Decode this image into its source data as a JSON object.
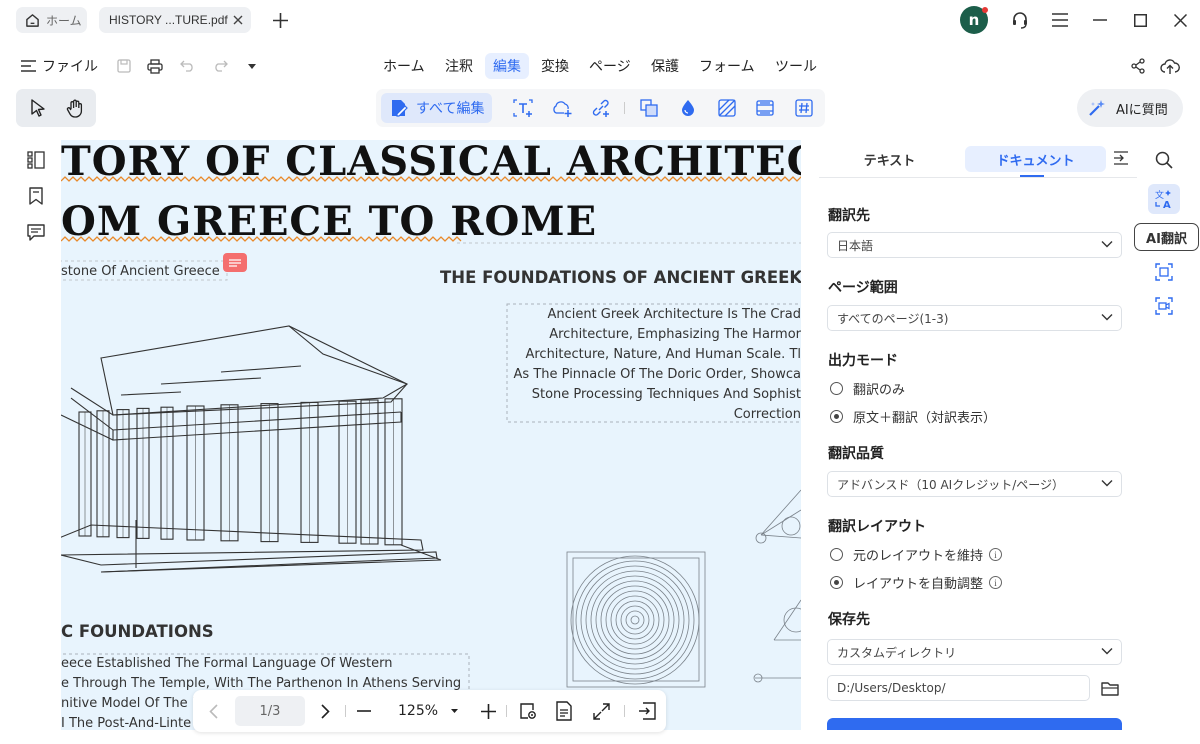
{
  "titlebar": {
    "home_tab": "ホーム",
    "doc_tab": "HISTORY ...TURE.pdf",
    "avatar_letter": "n"
  },
  "menubar": {
    "file_label": "ファイル",
    "tabs": [
      "ホーム",
      "注釈",
      "編集",
      "変換",
      "ページ",
      "保護",
      "フォーム",
      "ツール"
    ],
    "active_tab": "編集"
  },
  "toolbar": {
    "edit_all_label": "すべて編集",
    "ai_ask_label": "AIに質問"
  },
  "document": {
    "title_line1": "TORY OF CLASSICAL  ARCHITECTUR",
    "title_line2": "OM GREECE TO ROME",
    "caption": "stone Of Ancient Greece",
    "heading_right": "THE FOUNDATIONS OF ANCIENT GREEK AR",
    "para_right": [
      "Ancient Greek Architecture Is The Crad",
      "Architecture, Emphasizing The Harmor",
      "Architecture, Nature, And Human Scale. Tl",
      "As The Pinnacle Of The Doric Order, Showca",
      "Stone Processing Techniques And Sophist",
      "Correction"
    ],
    "heading_left": "C FOUNDATIONS",
    "para_left": [
      "eece Established The Formal Language Of Western",
      "e Through The Temple, With The Parthenon In Athens Serving",
      "nitive Model Of The D",
      "I The Post-And-Linte"
    ]
  },
  "bottombar": {
    "page_indicator": "1/3",
    "zoom": "125%"
  },
  "panel": {
    "tab_text": "テキスト",
    "tab_document": "ドキュメント",
    "target_label": "翻訳先",
    "target_value": "日本語",
    "range_label": "ページ範囲",
    "range_value": "すべてのページ(1-3)",
    "mode_label": "出力モード",
    "mode_options": [
      "翻訳のみ",
      "原文＋翻訳（対訳表示）"
    ],
    "mode_selected": 1,
    "quality_label": "翻訳品質",
    "quality_value": "アドバンスド（10 AIクレジット/ページ）",
    "layout_label": "翻訳レイアウト",
    "layout_options": [
      "元のレイアウトを維持",
      "レイアウトを自動調整"
    ],
    "layout_selected": 1,
    "save_label": "保存先",
    "save_value": "カスタムディレクトリ",
    "path_value": "D:/Users/Desktop/",
    "info_glyph": "i"
  },
  "rightrail": {
    "ai_translate_label": "AI翻訳"
  },
  "colors": {
    "accent": "#2f6bf0",
    "doc_bg": "#e8f4fd",
    "avatar_bg": "#1c5e4a",
    "wavy": "#e8892a"
  }
}
